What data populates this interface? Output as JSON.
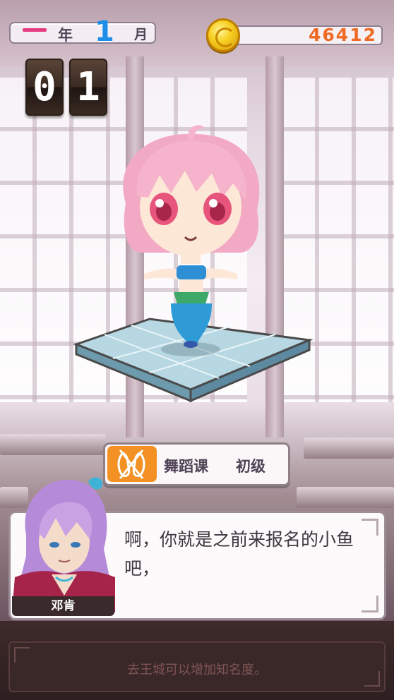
{
  "hud": {
    "year_label": "年",
    "month_value": "1",
    "month_label": "月",
    "gold": "46412",
    "day_digit_1": "0",
    "day_digit_2": "1"
  },
  "lesson": {
    "title": "舞蹈课",
    "level": "初级"
  },
  "dialog": {
    "speaker": "邓肯",
    "text": "啊，你就是之前来报名的小鱼吧，"
  },
  "tip": {
    "text": "去王城可以增加知名度。"
  },
  "colors": {
    "accent_pink": "#e43a80",
    "month_blue": "#1e8ee8",
    "gold_orange": "#ef6a24",
    "lesson_icon_orange": "#f39124"
  }
}
